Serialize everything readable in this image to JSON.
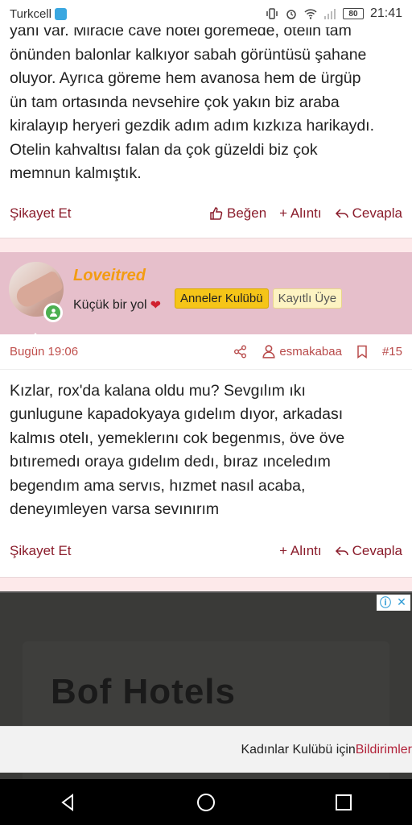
{
  "status_bar": {
    "carrier": "Turkcell",
    "battery": "80",
    "time": "21:41"
  },
  "post1": {
    "lines": [
      "yanı var. Miracle cave hotel göremede, otelin tam",
      "önünden balonlar kalkıyor sabah görüntüsü şahane",
      "oluyor. Ayrıca göreme hem avanosa hem de ürgüp",
      "ün tam ortasında nevsehire çok yakın biz araba",
      "kiralayıp heryeri gezdik adım adım kızkıza harikaydı.",
      "Otelin kahvaltısı falan da çok güzeldi biz çok",
      "memnun kalmıştık."
    ],
    "report_label": "Şikayet Et",
    "like_label": "Beğen",
    "quote_label": "+ Alıntı",
    "reply_label": "Cevapla"
  },
  "post2": {
    "username": "Loveitred",
    "user_title": "Küçük bir yol",
    "badge_club": "Anneler Kulübü",
    "badge_member": "Kayıtlı Üye",
    "date": "Bugün 19:06",
    "author": "esmakabaa",
    "post_number": "#15",
    "lines": [
      "Kızlar, rox'da kalana oldu mu? Sevgılım ıkı",
      "gunlugune kapadokyaya gıdelım dıyor, arkadası",
      "kalmıs otelı, yemeklerını cok begenmıs, öve öve",
      "bıtıremedı oraya gıdelım dedı, bıraz ınceledım",
      "begendım ama servıs, hızmet nasıl acaba,",
      "deneyımleyen varsa sevınırım"
    ],
    "report_label": "Şikayet Et",
    "quote_label": "+ Alıntı",
    "reply_label": "Cevapla"
  },
  "ad": {
    "title": "Bof Hotels"
  },
  "notification": {
    "text": "Kadınlar Kulübü için ",
    "link": "Bildirimler"
  },
  "colors": {
    "accent": "#8a1c2b",
    "header_bg": "#e6bfcb",
    "username": "#f39c12"
  }
}
